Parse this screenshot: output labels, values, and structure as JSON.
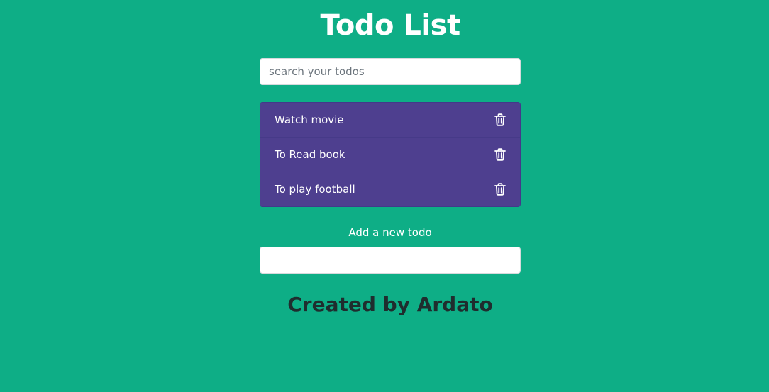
{
  "header": {
    "title": "Todo List"
  },
  "search": {
    "placeholder": "search your todos",
    "value": ""
  },
  "todos": {
    "items": [
      {
        "label": "Watch movie",
        "icon": "trash-icon"
      },
      {
        "label": "To Read book",
        "icon": "trash-icon"
      },
      {
        "label": "To play football",
        "icon": "trash-icon"
      }
    ]
  },
  "add_form": {
    "label": "Add a new todo",
    "value": ""
  },
  "footer": {
    "text": "Created by Ardato"
  },
  "colors": {
    "background": "#0eae86",
    "list_item": "#4e3f8f",
    "footer_text": "#1f2d2e"
  }
}
